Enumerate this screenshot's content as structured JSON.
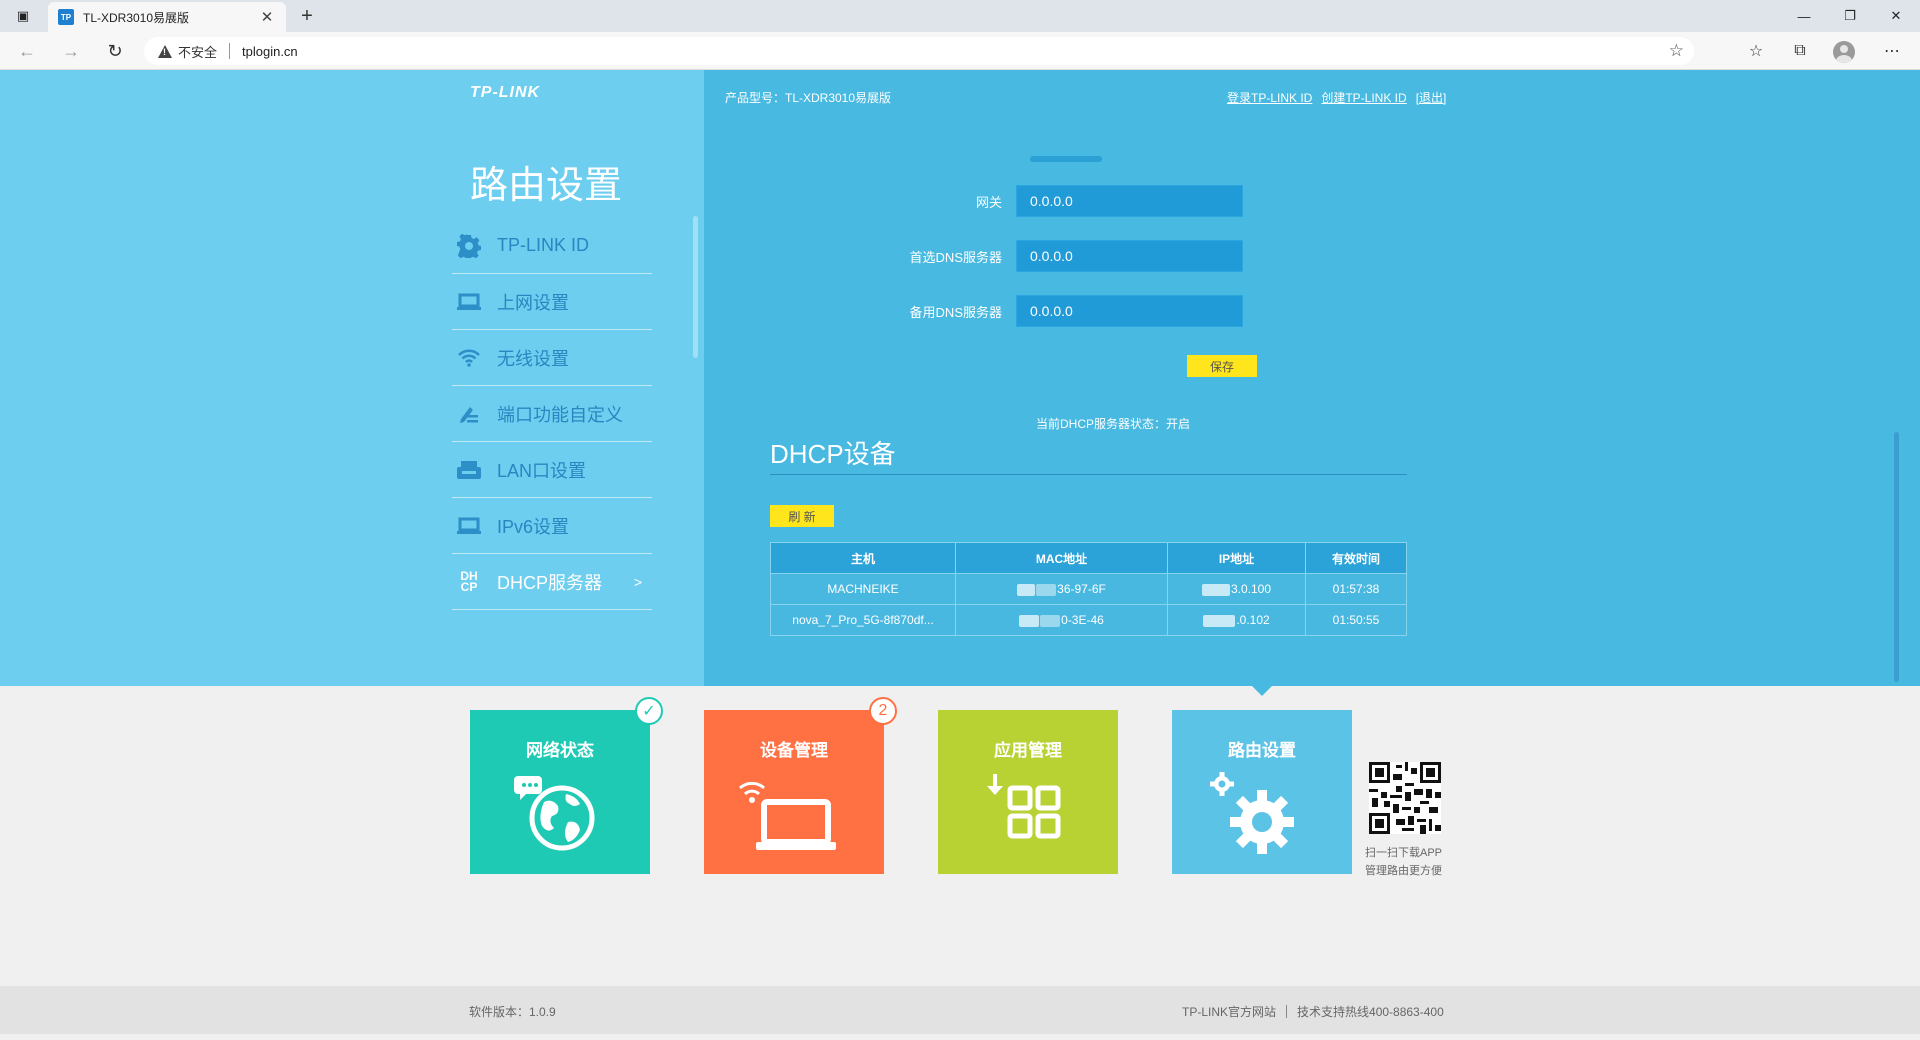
{
  "browser": {
    "tab_title": "TL-XDR3010易展版",
    "tab_favicon": "TP",
    "new_tab_glyph": "+",
    "security_label": "不安全",
    "url": "tplogin.cn"
  },
  "header": {
    "logo": "TP-LINK",
    "product_label": "产品型号：TL-XDR3010易展版",
    "links": [
      "登录TP-LINK ID",
      "创建TP-LINK ID",
      "[退出]"
    ]
  },
  "sidebar": {
    "title": "路由设置",
    "items": [
      {
        "label": "TP-LINK ID",
        "icon": "gear-icon"
      },
      {
        "label": "上网设置",
        "icon": "laptop-icon"
      },
      {
        "label": "无线设置",
        "icon": "wifi-icon"
      },
      {
        "label": "端口功能自定义",
        "icon": "port-custom-icon"
      },
      {
        "label": "LAN口设置",
        "icon": "lan-icon"
      },
      {
        "label": "IPv6设置",
        "icon": "laptop-icon"
      },
      {
        "label": "DHCP服务器",
        "icon": "dhcp-icon",
        "arrow": ">"
      }
    ]
  },
  "form": {
    "gateway_label": "网关",
    "gateway_value": "0.0.0.0",
    "dns1_label": "首选DNS服务器",
    "dns1_value": "0.0.0.0",
    "dns2_label": "备用DNS服务器",
    "dns2_value": "0.0.0.0",
    "save_label": "保存"
  },
  "dhcp": {
    "status_text": "当前DHCP服务器状态：开启",
    "section_title": "DHCP设备",
    "refresh_label": "刷 新",
    "columns": [
      "主机",
      "MAC地址",
      "IP地址",
      "有效时间"
    ],
    "rows": [
      {
        "host": "MACHNEIKE",
        "mac_suffix": "36-97-6F",
        "ip_suffix": "3.0.100",
        "lease": "01:57:38"
      },
      {
        "host": "nova_7_Pro_5G-8f870df...",
        "mac_suffix": "0-3E-46",
        "ip_suffix": ".0.102",
        "lease": "01:50:55"
      }
    ]
  },
  "tiles": [
    {
      "label": "网络状态",
      "color": "#1fcab4",
      "icon": "globe-icon",
      "badge": "✓"
    },
    {
      "label": "设备管理",
      "color": "#ff7043",
      "icon": "laptop-icon",
      "badge": "2"
    },
    {
      "label": "应用管理",
      "color": "#b8d133",
      "icon": "apps-icon"
    },
    {
      "label": "路由设置",
      "color": "#5bc3e6",
      "icon": "gears-icon"
    }
  ],
  "qr": {
    "line1": "扫一扫下载APP",
    "line2": "管理路由更方便"
  },
  "footer": {
    "version": "软件版本：1.0.9",
    "site": "TP-LINK官方网站",
    "hotline": "技术支持热线400-8863-400"
  },
  "colors": {
    "sidebar_bg": "#6dcef0",
    "content_bg": "#48b9e0",
    "input_bg": "#219bd8",
    "button_yellow": "#ffe61c"
  }
}
